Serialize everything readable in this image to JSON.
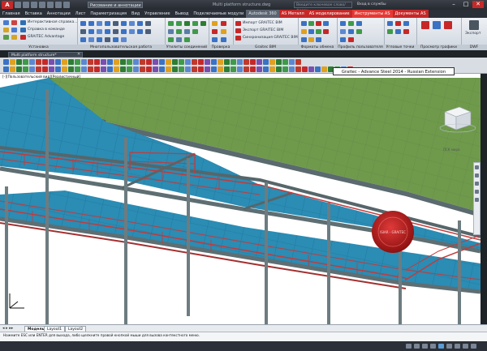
{
  "app": {
    "logo": "A",
    "workspace": "Рисование и аннотации",
    "window_title": "Multi platform structure.dwg",
    "search_placeholder": "Введите ключевое слово/фразу",
    "sign_in": "Вход в службы"
  },
  "window_controls": {
    "minimize": "–",
    "maximize": "□",
    "close": "✕"
  },
  "ribbon_tabs": [
    {
      "label": "Главная",
      "state": "normal"
    },
    {
      "label": "Вставка",
      "state": "normal"
    },
    {
      "label": "Аннотации",
      "state": "normal"
    },
    {
      "label": "Лист",
      "state": "normal"
    },
    {
      "label": "Параметризация",
      "state": "normal"
    },
    {
      "label": "Вид",
      "state": "normal"
    },
    {
      "label": "Управление",
      "state": "normal"
    },
    {
      "label": "Вывод",
      "state": "normal"
    },
    {
      "label": "Подключаемые модули",
      "state": "normal"
    },
    {
      "label": "Autodesk 360",
      "state": "active"
    },
    {
      "label": "AS Металл",
      "state": "red"
    },
    {
      "label": "AS моделирование",
      "state": "red"
    },
    {
      "label": "Инструменты AS",
      "state": "red-selected"
    },
    {
      "label": "Документы AS",
      "state": "red"
    }
  ],
  "ribbon": {
    "left_links": [
      "Интерактивная справка...",
      "Справка в команде",
      "GRAITEC Advantage"
    ],
    "graitec_links": [
      "Импорт GRAITEC BIM",
      "Экспорт GRAITEC BIM",
      "Синхронизация GRAITEC BIM"
    ],
    "export_label": "Экспорт",
    "panels": [
      "Установка",
      "Многопользовательская работа",
      "Утилиты соединений",
      "Проверка",
      "Graitec BIM",
      "Форматы обмена",
      "Профиль пользователя",
      "Угловые точки",
      "Просмотр графики",
      "DWF"
    ]
  },
  "document": {
    "tab_label": "Multi platform structure*",
    "close": "✕"
  },
  "extension_label": "Graitec - Advance Steel 2014 - Russian Extension",
  "viewport_label": "[-][Пользовательский вид][Реалистичный]",
  "viewcube_label": "ПСК мира",
  "layout_tabs": [
    "Модель",
    "Layout1",
    "Layout2"
  ],
  "command_line": "Нажмите ESC или ENTER для выхода, либо щелкните правой кнопкой мыши для вызова контекстного меню.",
  "colors": {
    "accent_red": "#c62828",
    "steel_gray": "#6d7c80",
    "rail_red": "#c43a3a",
    "floor_blue": "#2b8cb4",
    "roof_green": "#6f9a4c"
  },
  "seal_text": "ISIAR - GRAITEC"
}
